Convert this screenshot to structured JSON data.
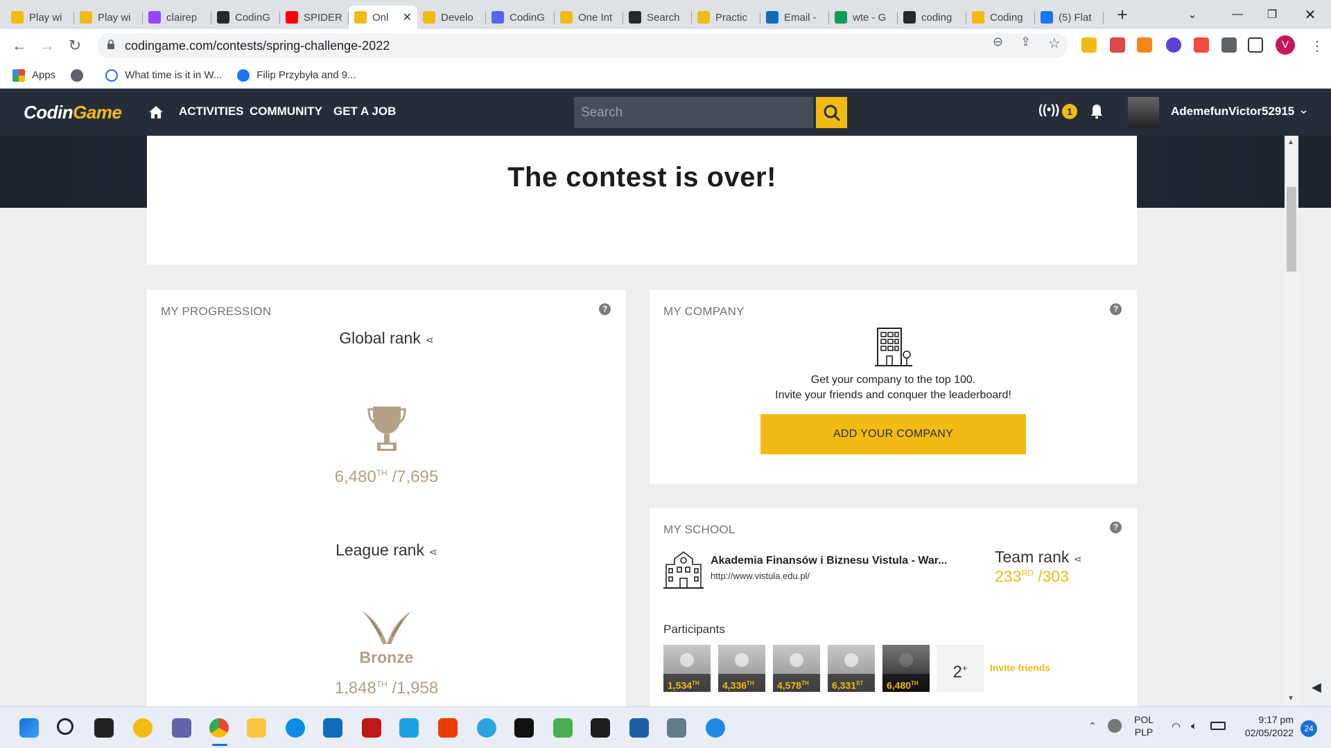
{
  "browser": {
    "tabs": [
      {
        "title": "Play wi",
        "favicon": "codingame-icon",
        "color": "#f2bb13"
      },
      {
        "title": "Play wi",
        "favicon": "codingame-icon",
        "color": "#f2bb13"
      },
      {
        "title": "clairep",
        "favicon": "twitch-icon",
        "color": "#9146ff"
      },
      {
        "title": "CodinG",
        "favicon": "github-icon",
        "color": "#24292e"
      },
      {
        "title": "SPIDER",
        "favicon": "youtube-icon",
        "color": "#ff0000"
      },
      {
        "title": "Onl",
        "favicon": "codingame-icon",
        "color": "#f2bb13",
        "active": true
      },
      {
        "title": "Develo",
        "favicon": "codingame-icon",
        "color": "#f2bb13"
      },
      {
        "title": "CodinG",
        "favicon": "discord-icon",
        "color": "#5865f2"
      },
      {
        "title": "One Int",
        "favicon": "codingame-icon",
        "color": "#f2bb13"
      },
      {
        "title": "Search",
        "favicon": "github-icon",
        "color": "#24292e"
      },
      {
        "title": "Practic",
        "favicon": "codingame-icon",
        "color": "#f2bb13"
      },
      {
        "title": "Email -",
        "favicon": "outlook-icon",
        "color": "#0f6cbd"
      },
      {
        "title": "wte - G",
        "favicon": "sheets-icon",
        "color": "#0f9d58"
      },
      {
        "title": "coding",
        "favicon": "github-icon",
        "color": "#24292e"
      },
      {
        "title": "Coding",
        "favicon": "codingame-icon",
        "color": "#f2bb13"
      },
      {
        "title": "(5) Flat",
        "favicon": "facebook-icon",
        "color": "#1877f2"
      }
    ],
    "url": "codingame.com/contests/spring-challenge-2022",
    "profile_initial": "V",
    "bookmarks": [
      "Apps",
      "",
      "What time is it in W...",
      "Filip Przybyła and 9..."
    ]
  },
  "site": {
    "logo": [
      "Codin",
      "Game"
    ],
    "nav": [
      "ACTIVITIES",
      "COMMUNITY",
      "GET A JOB"
    ],
    "search_placeholder": "Search",
    "notif_count": "1",
    "username": "AdemefunVictor52915"
  },
  "banner": {
    "title": "The contest is over!"
  },
  "progression": {
    "title": "MY PROGRESSION",
    "global_label": "Global rank",
    "global_rank": "6,480",
    "global_suffix": "TH",
    "global_total": "/7,695",
    "league_label": "League rank",
    "league_name": "Bronze",
    "league_rank": "1,848",
    "league_suffix": "TH",
    "league_total": "/1,958"
  },
  "company": {
    "title": "MY COMPANY",
    "line1": "Get your company to the top 100.",
    "line2": "Invite your friends and conquer the leaderboard!",
    "button": "ADD YOUR COMPANY"
  },
  "school": {
    "title": "MY SCHOOL",
    "name": "Akademia Finansów i Biznesu Vistula - War...",
    "url": "http://www.vistula.edu.pl/",
    "team_label": "Team rank",
    "team_rank": "233",
    "team_suffix": "RD",
    "team_total": "/303",
    "participants_label": "Participants",
    "participants": [
      {
        "rank": "1,534",
        "suffix": "TH"
      },
      {
        "rank": "4,336",
        "suffix": "TH"
      },
      {
        "rank": "4,578",
        "suffix": "TH"
      },
      {
        "rank": "6,331",
        "suffix": "ST"
      },
      {
        "rank": "6,480",
        "suffix": "TH"
      }
    ],
    "more": "2",
    "more_sup": "+",
    "invite": "Invite friends"
  },
  "taskbar": {
    "lang1": "POL",
    "lang2": "PLP",
    "time": "9:17 pm",
    "date": "02/05/2022",
    "badge": "24"
  }
}
